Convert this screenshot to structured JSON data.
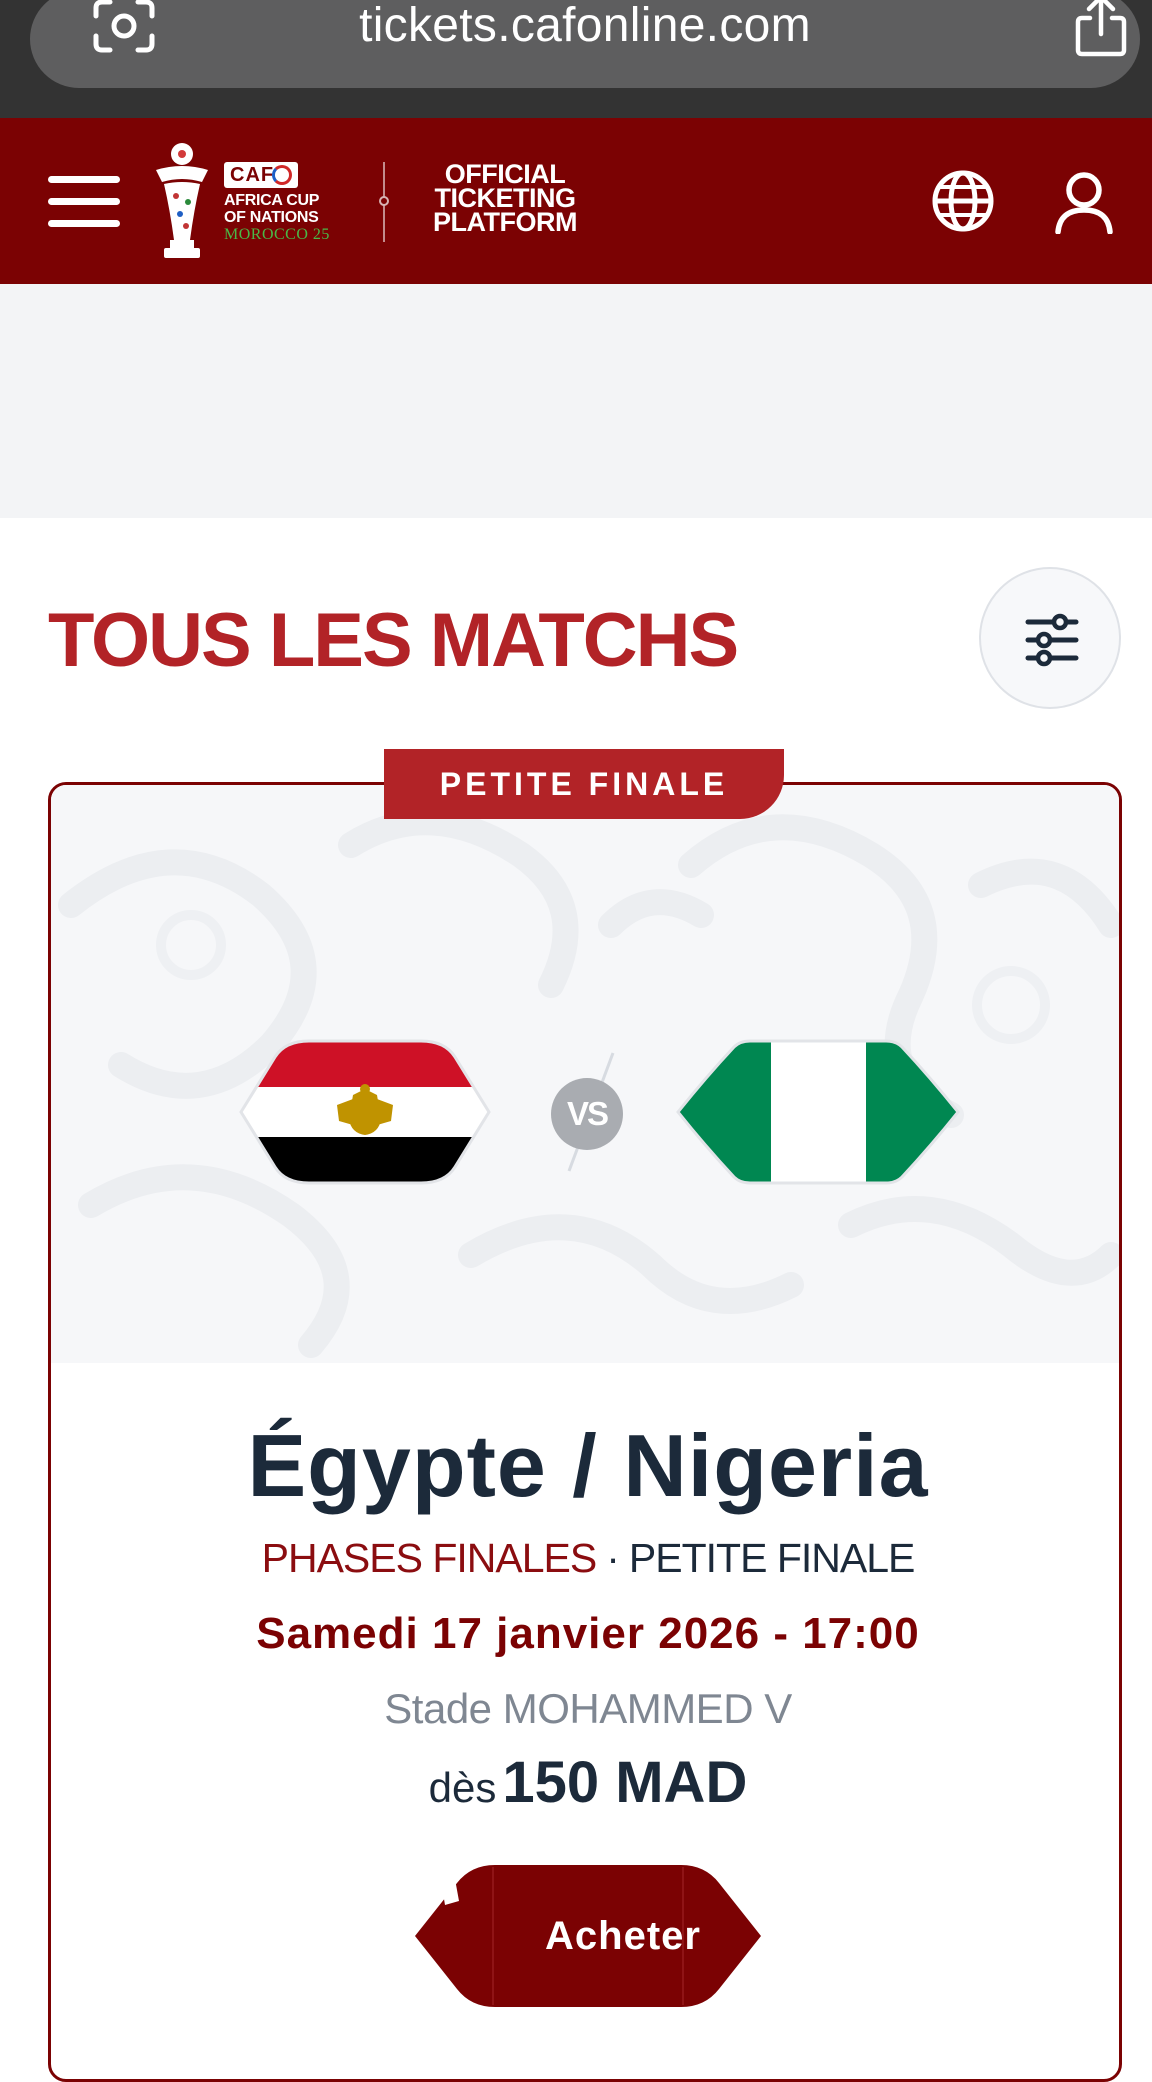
{
  "browser": {
    "url": "tickets.cafonline.com"
  },
  "header": {
    "caf_badge": "CAF",
    "brand_lines": [
      "AFRICA CUP",
      "OF NATIONS"
    ],
    "brand_edition": "MOROCCO 25",
    "platform_lines": [
      "OFFICIAL",
      "TICKETING",
      "PLATFORM"
    ],
    "background_color": "#7b0203"
  },
  "page": {
    "title": "TOUS LES MATCHS",
    "accent_color": "#b22327"
  },
  "match": {
    "stage_tab": "PETITE FINALE",
    "home_team_flag": "egypt-flag",
    "away_team_flag": "nigeria-flag",
    "vs_label": "VS",
    "title": "Égypte / Nigeria",
    "phase": "PHASES FINALES",
    "separator": "·",
    "stage": "PETITE FINALE",
    "datetime": "Samedi 17 janvier 2026 - 17:00",
    "venue": "Stade MOHAMMED V",
    "price_prefix": "dès",
    "price": "150 MAD",
    "buy_label": "Acheter"
  },
  "icons": {
    "browser_left": "lens-icon",
    "browser_right": "share-icon",
    "menu": "hamburger-icon",
    "language": "globe-icon",
    "account": "user-icon",
    "filters": "sliders-icon",
    "buy": "ticket-icon"
  }
}
